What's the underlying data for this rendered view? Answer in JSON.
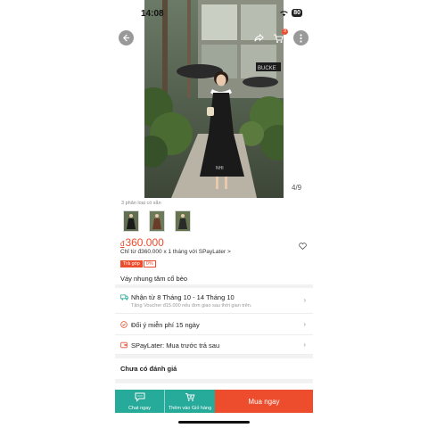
{
  "status_bar": {
    "time": "14:08",
    "battery": "80"
  },
  "header": {
    "cart_badge": "9",
    "photo_counter": "4/9"
  },
  "hero_photo": {
    "store_sign": "BUCKE",
    "watermark": "NHI"
  },
  "variants": {
    "caption": "3 phân loại có sẵn",
    "count": 3
  },
  "price": {
    "currency": "đ",
    "amount": "360.000",
    "installment": "Chỉ từ đ360.000 x 1 tháng với",
    "spaylater": "SPayLater",
    "chevron": ">"
  },
  "tags": {
    "tra_gop": "Trả góp",
    "percent": "0%"
  },
  "product": {
    "title": "Váy nhung tăm cổ bèo"
  },
  "delivery": {
    "main": "Nhận từ 8 Tháng 10 - 14 Tháng 10",
    "sub": "Tặng Voucher đ15.000 nếu đơn giao sau thời gian trên."
  },
  "returns": {
    "main": "Đổi ý miễn phí 15 ngày"
  },
  "spaylater_row": {
    "main": "SPayLater: Mua trước trả sau"
  },
  "reviews": {
    "title": "Chưa có đánh giá"
  },
  "bottom_bar": {
    "chat_label": "Chat ngay",
    "cart_label": "Thêm vào Giỏ hàng",
    "buy_label": "Mua ngay"
  },
  "colors": {
    "accent": "#ee4d2d",
    "teal": "#26aa99"
  }
}
